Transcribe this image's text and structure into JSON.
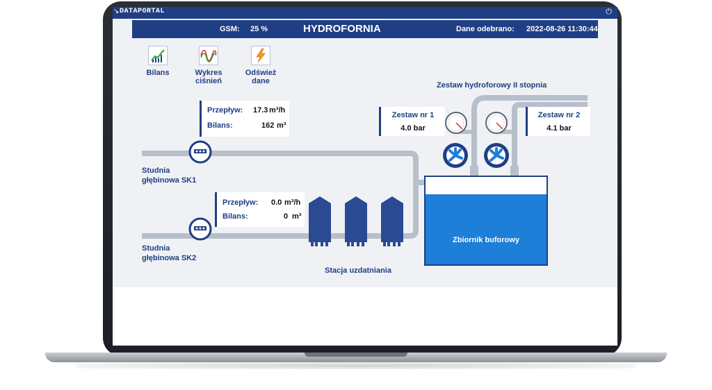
{
  "titlebar": {
    "logo_text": "DATAPORTAL",
    "back_icon": "resize-arrow-icon",
    "power_icon": "power-icon"
  },
  "header": {
    "gsm_label": "GSM:",
    "gsm_value": "25 %",
    "title": "HYDROFORNIA",
    "received_label": "Dane odebrano:",
    "received_value": "2022-08-26 11:30:44"
  },
  "toolbar": {
    "bilans": "Bilans",
    "wykres_line1": "Wykres",
    "wykres_line2": "ciśnień",
    "odswiez_line1": "Odśwież",
    "odswiez_line2": "dane"
  },
  "sk1": {
    "name_line1": "Studnia",
    "name_line2": "głębinowa SK1",
    "flow_label": "Przepływ:",
    "flow_value": "17.3",
    "flow_unit": "m³/h",
    "balance_label": "Bilans:",
    "balance_value": "162",
    "balance_unit": "m³"
  },
  "sk2": {
    "name_line1": "Studnia",
    "name_line2": "głębinowa SK2",
    "flow_label": "Przepływ:",
    "flow_value": "0.0",
    "flow_unit": "m³/h",
    "balance_label": "Bilans:",
    "balance_value": "0",
    "balance_unit": "m³"
  },
  "station": {
    "label": "Stacja uzdatniania"
  },
  "tank": {
    "label": "Zbiornik buforowy"
  },
  "booster": {
    "title": "Zestaw hydroforowy II stopnia",
    "set1_label": "Zestaw nr 1",
    "set1_value": "4.0 bar",
    "set2_label": "Zestaw nr 2",
    "set2_value": "4.1 bar"
  },
  "colors": {
    "brand": "#1f3e84",
    "pipe": "#b7bfcb",
    "tank_water": "#1e7fd8",
    "tower": "#2a4b93"
  }
}
